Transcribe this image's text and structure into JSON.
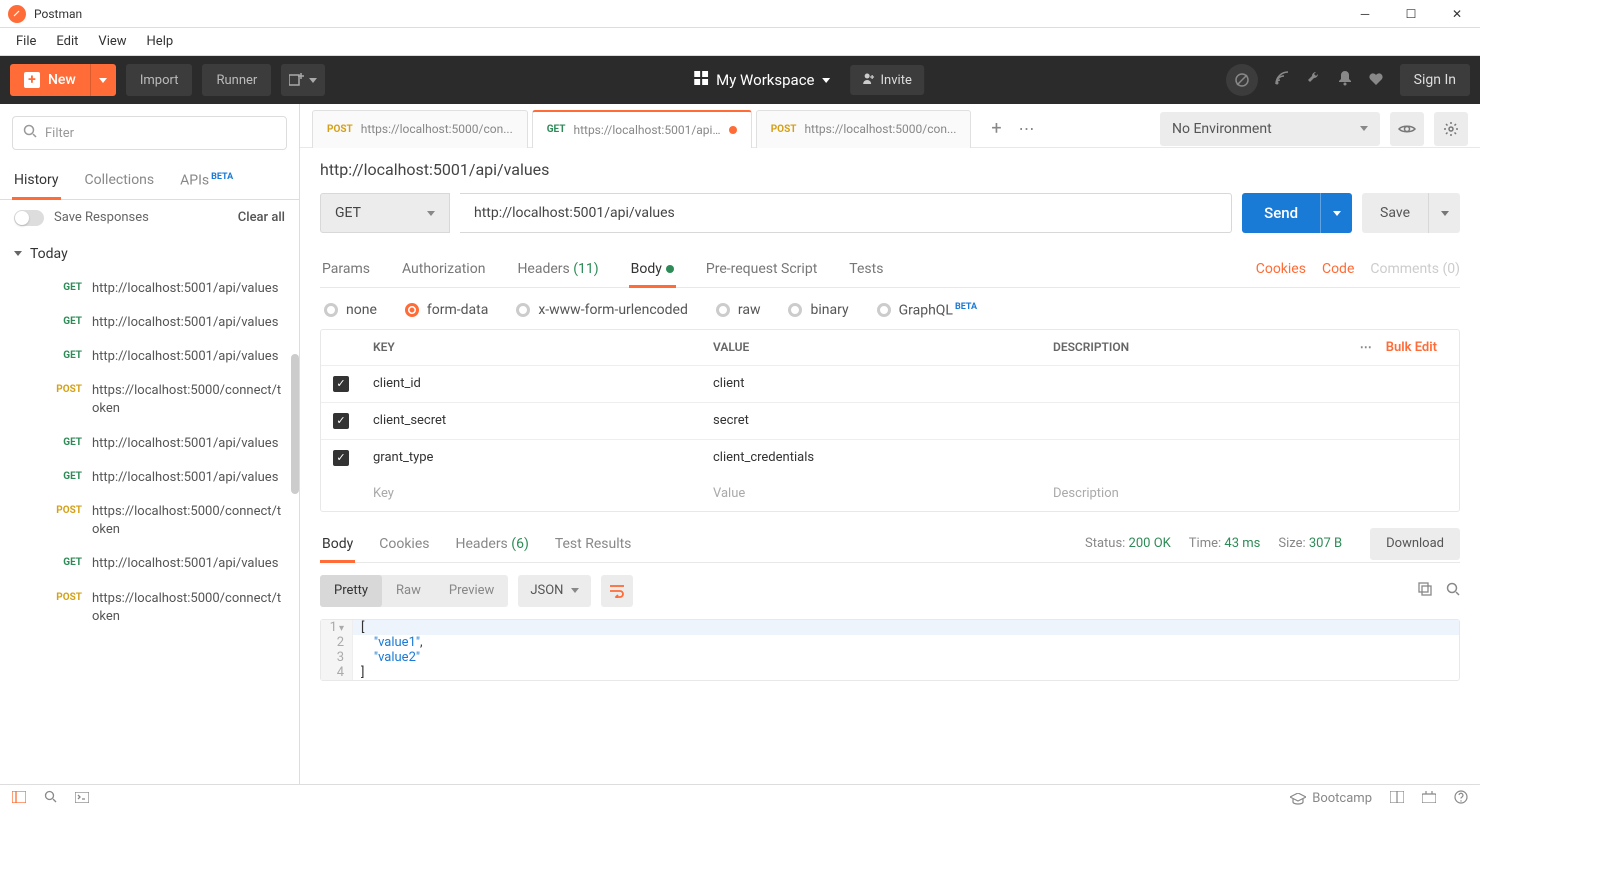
{
  "app": {
    "title": "Postman"
  },
  "menu": [
    "File",
    "Edit",
    "View",
    "Help"
  ],
  "darkbar": {
    "new": "New",
    "import": "Import",
    "runner": "Runner",
    "workspace": "My Workspace",
    "invite": "Invite",
    "signin": "Sign In"
  },
  "sidebar": {
    "filter_placeholder": "Filter",
    "tabs": {
      "history": "History",
      "collections": "Collections",
      "apis": "APIs",
      "beta": "BETA"
    },
    "save_responses": "Save Responses",
    "clear_all": "Clear all",
    "group": "Today",
    "items": [
      {
        "method": "GET",
        "url": "http://localhost:5001/api/values"
      },
      {
        "method": "GET",
        "url": "http://localhost:5001/api/values"
      },
      {
        "method": "GET",
        "url": "http://localhost:5001/api/values"
      },
      {
        "method": "POST",
        "url": "https://localhost:5000/connect/token"
      },
      {
        "method": "GET",
        "url": "http://localhost:5001/api/values"
      },
      {
        "method": "GET",
        "url": "http://localhost:5001/api/values"
      },
      {
        "method": "POST",
        "url": "https://localhost:5000/connect/token"
      },
      {
        "method": "GET",
        "url": "http://localhost:5001/api/values"
      },
      {
        "method": "POST",
        "url": "https://localhost:5000/connect/token"
      }
    ]
  },
  "tabs": [
    {
      "method": "POST",
      "label": "https://localhost:5000/con...",
      "active": false,
      "dirty": false
    },
    {
      "method": "GET",
      "label": "https://localhost:5001/api/v...",
      "active": true,
      "dirty": true
    },
    {
      "method": "POST",
      "label": "https://localhost:5000/con...",
      "active": false,
      "dirty": false
    }
  ],
  "env": {
    "label": "No Environment"
  },
  "request": {
    "title": "http://localhost:5001/api/values",
    "method": "GET",
    "url": "http://localhost:5001/api/values",
    "send": "Send",
    "save": "Save",
    "tabs": {
      "params": "Params",
      "auth": "Authorization",
      "headers": "Headers",
      "headers_count": "(11)",
      "body": "Body",
      "prerequest": "Pre-request Script",
      "tests": "Tests"
    },
    "links": {
      "cookies": "Cookies",
      "code": "Code",
      "comments": "Comments (0)"
    },
    "body_types": {
      "none": "none",
      "formdata": "form-data",
      "xwww": "x-www-form-urlencoded",
      "raw": "raw",
      "binary": "binary",
      "graphql": "GraphQL",
      "beta": "BETA"
    },
    "table": {
      "headers": {
        "key": "KEY",
        "value": "VALUE",
        "desc": "DESCRIPTION",
        "bulk": "Bulk Edit"
      },
      "rows": [
        {
          "key": "client_id",
          "value": "client"
        },
        {
          "key": "client_secret",
          "value": "secret"
        },
        {
          "key": "grant_type",
          "value": "client_credentials"
        }
      ],
      "placeholders": {
        "key": "Key",
        "value": "Value",
        "desc": "Description"
      }
    }
  },
  "response": {
    "tabs": {
      "body": "Body",
      "cookies": "Cookies",
      "headers": "Headers",
      "headers_count": "(6)",
      "tests": "Test Results"
    },
    "status_label": "Status:",
    "status_value": "200 OK",
    "time_label": "Time:",
    "time_value": "43 ms",
    "size_label": "Size:",
    "size_value": "307 B",
    "download": "Download",
    "views": {
      "pretty": "Pretty",
      "raw": "Raw",
      "preview": "Preview"
    },
    "format": "JSON",
    "code": {
      "l1": "[",
      "l2a": "\"value1\"",
      "l2b": ",",
      "l3": "\"value2\"",
      "l4": "]"
    }
  },
  "statusbar": {
    "bootcamp": "Bootcamp"
  }
}
